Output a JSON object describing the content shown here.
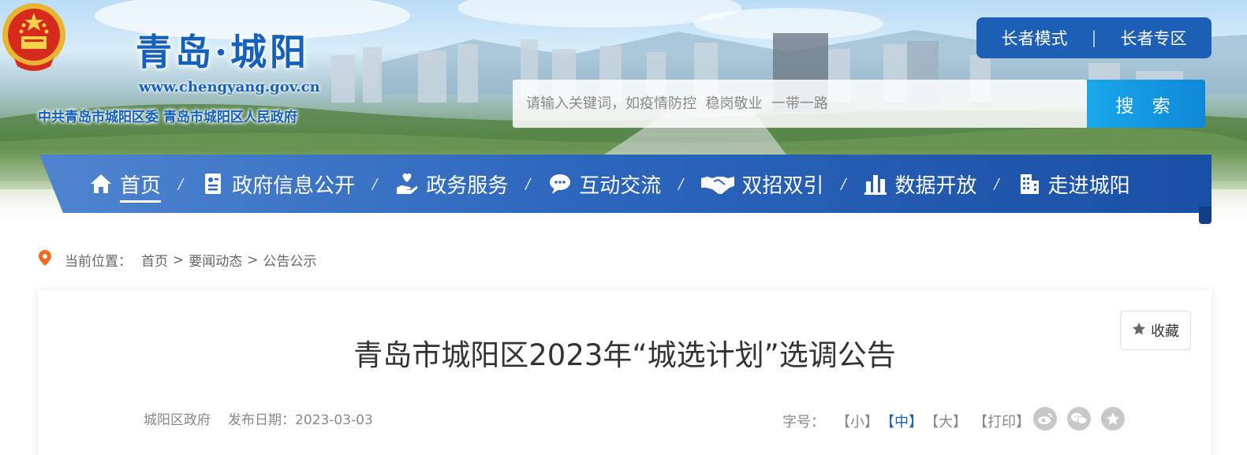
{
  "header": {
    "site_title": "青岛·城阳",
    "site_url": "www.chengyang.gov.cn",
    "site_subtitle": "中共青岛市城阳区委  青岛市城阳区人民政府",
    "elder_mode": "长者模式",
    "elder_zone": "长者专区",
    "elder_separator": "|"
  },
  "search": {
    "placeholder": "请输入关键词，如疫情防控  稳岗敬业  一带一路",
    "button_label": "搜 索"
  },
  "nav": {
    "items": [
      {
        "label": "首页",
        "icon": "home-icon"
      },
      {
        "label": "政府信息公开",
        "icon": "document-icon"
      },
      {
        "label": "政务服务",
        "icon": "hand-heart-icon"
      },
      {
        "label": "互动交流",
        "icon": "chat-icon"
      },
      {
        "label": "双招双引",
        "icon": "handshake-icon"
      },
      {
        "label": "数据开放",
        "icon": "bar-chart-icon"
      },
      {
        "label": "走进城阳",
        "icon": "building-icon"
      }
    ],
    "separator": "/"
  },
  "breadcrumb": {
    "prefix": "当前位置：",
    "items": [
      "首页",
      "要闻动态",
      "公告公示"
    ],
    "sep": ">"
  },
  "article": {
    "title": "青岛市城阳区2023年“城选计划”选调公告",
    "source": "城阳区政府",
    "date_label": "发布日期：2023-03-03",
    "favorite_label": "收藏",
    "fontsize_label": "字号：",
    "fontsize_small": "【小】",
    "fontsize_medium": "【中】",
    "fontsize_large": "【大】",
    "print_label": "【打印】"
  },
  "colors": {
    "brand_blue": "#1d5fb4",
    "search_blue": "#1aa7ea",
    "pin_orange": "#f26b1d"
  }
}
